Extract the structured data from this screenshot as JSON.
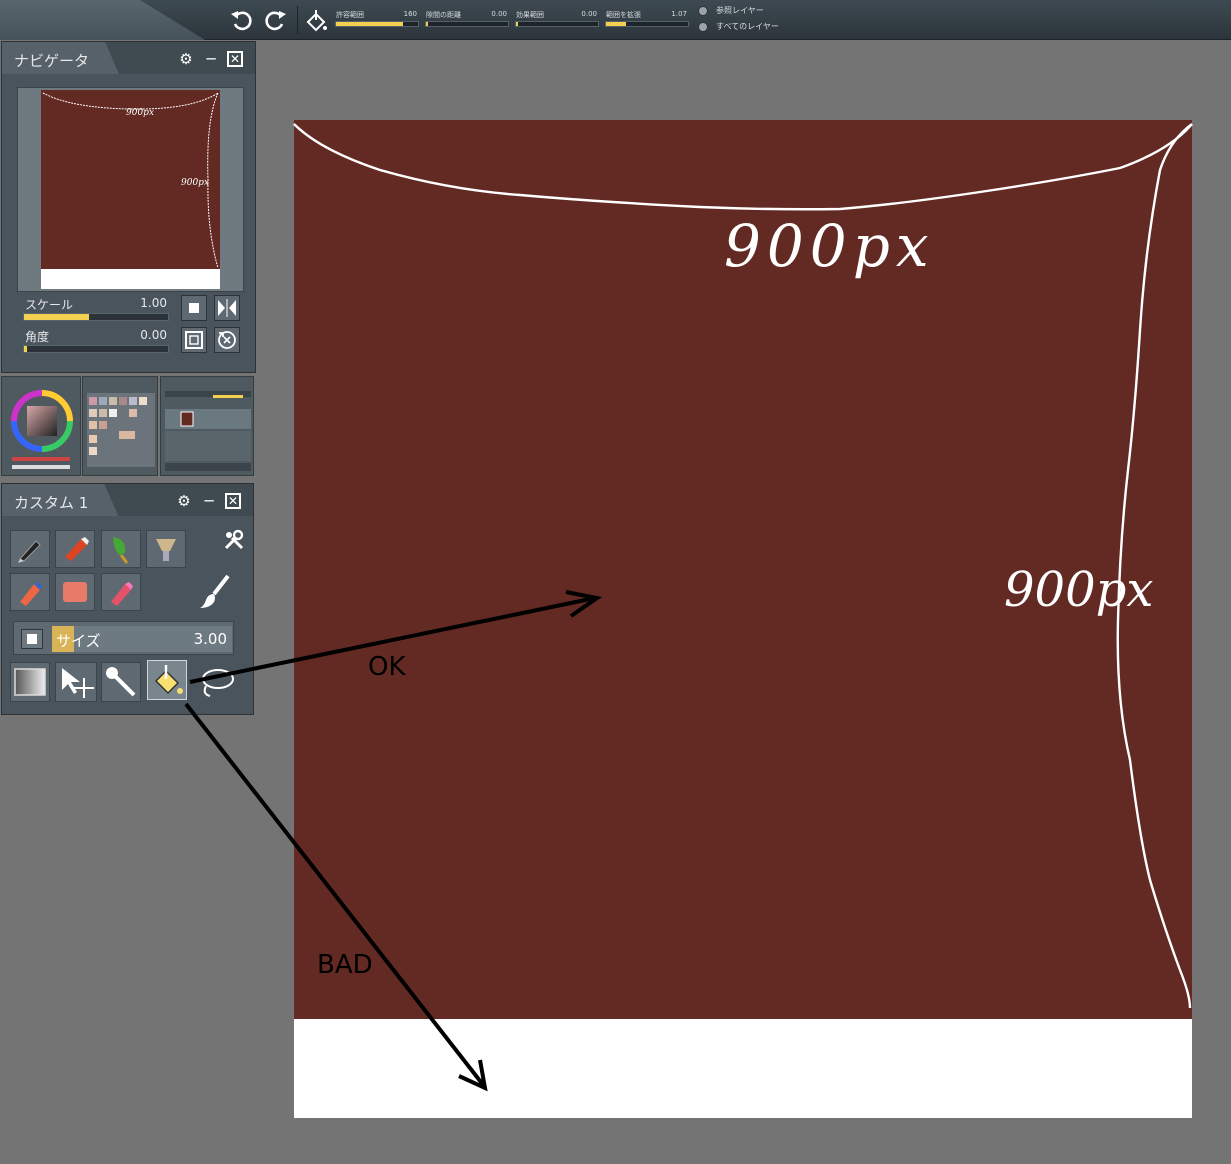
{
  "toolbar": {
    "sliders": [
      {
        "label": "許容範囲",
        "value": "160",
        "fill": 0.82
      },
      {
        "label": "隙間の距離",
        "value": "0.00",
        "fill": 0.02
      },
      {
        "label": "効果範囲",
        "value": "0.00",
        "fill": 0.02
      },
      {
        "label": "範囲を拡張",
        "value": "1.07",
        "fill": 0.24
      }
    ],
    "radio_reference": "参照レイヤー",
    "radio_all": "すべてのレイヤー"
  },
  "navigator": {
    "title": "ナビゲータ",
    "scale_label": "スケール",
    "scale_value": "1.00",
    "scale_fill": 0.45,
    "angle_label": "角度",
    "angle_value": "0.00",
    "angle_fill": 0.02,
    "mini_width_text": "900px",
    "mini_height_text": "900px"
  },
  "custom_panel": {
    "title": "カスタム 1",
    "size_label": "サイズ",
    "size_value": "3.00",
    "size_fill": 0.12
  },
  "canvas": {
    "width_annotation": "900px",
    "height_annotation": "900px",
    "ok_label": "OK",
    "bad_label": "BAD"
  },
  "colors": {
    "canvas_fill": "#622a22",
    "accent": "#f4d04f",
    "panel": "#4a545c"
  }
}
